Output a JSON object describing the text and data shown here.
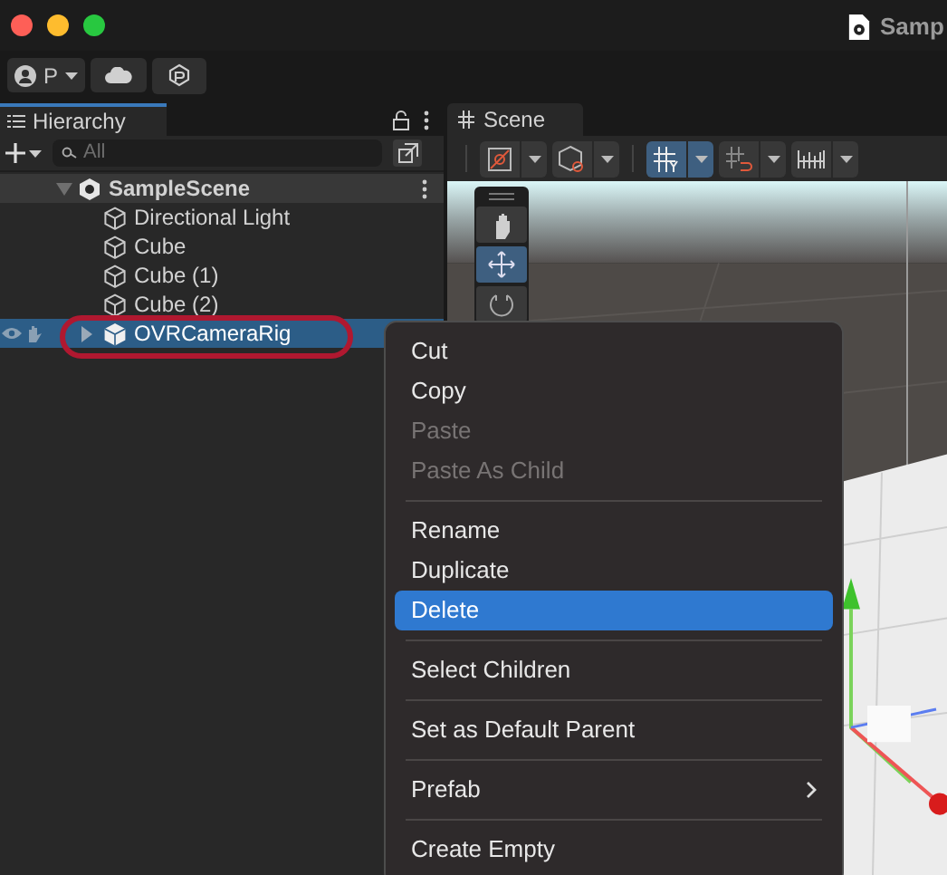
{
  "window": {
    "title": "Samp"
  },
  "toolbar": {
    "account": "P"
  },
  "hierarchy": {
    "tab": "Hierarchy",
    "search": {
      "placeholder": "All"
    },
    "tree": [
      {
        "kind": "scene",
        "label": "SampleScene",
        "expanded": true,
        "selected": false,
        "circled": false,
        "children": [
          {
            "kind": "object",
            "label": "Directional Light",
            "selected": false,
            "circled": false
          },
          {
            "kind": "object",
            "label": "Cube",
            "selected": false,
            "circled": false
          },
          {
            "kind": "object",
            "label": "Cube (1)",
            "selected": false,
            "circled": false
          },
          {
            "kind": "object",
            "label": "Cube (2)",
            "selected": false,
            "circled": false
          },
          {
            "kind": "prefab",
            "label": "OVRCameraRig",
            "expanded": false,
            "selected": true,
            "circled": true
          }
        ]
      }
    ]
  },
  "scene": {
    "tab": "Scene",
    "toolbar": [
      {
        "kind": "draw-mode",
        "selected": false
      },
      {
        "kind": "camera",
        "selected": false
      },
      {
        "kind": "grid",
        "selected": true
      },
      {
        "kind": "snap",
        "selected": false
      },
      {
        "kind": "increment",
        "selected": false
      }
    ],
    "tools": [
      {
        "kind": "hand",
        "selected": false
      },
      {
        "kind": "move",
        "selected": true
      },
      {
        "kind": "rotate",
        "selected": false
      }
    ]
  },
  "context_menu": [
    {
      "kind": "item",
      "label": "Cut",
      "disabled": false,
      "selected": false
    },
    {
      "kind": "item",
      "label": "Copy",
      "disabled": false,
      "selected": false
    },
    {
      "kind": "item",
      "label": "Paste",
      "disabled": true,
      "selected": false
    },
    {
      "kind": "item",
      "label": "Paste As Child",
      "disabled": true,
      "selected": false
    },
    {
      "kind": "separator"
    },
    {
      "kind": "item",
      "label": "Rename",
      "disabled": false,
      "selected": false
    },
    {
      "kind": "item",
      "label": "Duplicate",
      "disabled": false,
      "selected": false
    },
    {
      "kind": "item",
      "label": "Delete",
      "disabled": false,
      "selected": true
    },
    {
      "kind": "separator"
    },
    {
      "kind": "item",
      "label": "Select Children",
      "disabled": false,
      "selected": false
    },
    {
      "kind": "separator"
    },
    {
      "kind": "item",
      "label": "Set as Default Parent",
      "disabled": false,
      "selected": false
    },
    {
      "kind": "separator"
    },
    {
      "kind": "submenu",
      "label": "Prefab",
      "disabled": false,
      "selected": false
    },
    {
      "kind": "separator"
    },
    {
      "kind": "item",
      "label": "Create Empty",
      "disabled": false,
      "selected": false
    }
  ]
}
